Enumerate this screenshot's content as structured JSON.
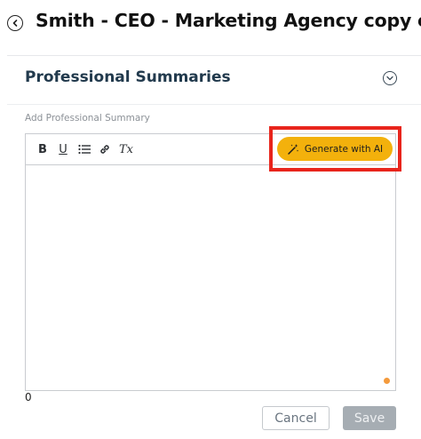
{
  "header": {
    "title": "Smith - CEO - Marketing Agency copy c"
  },
  "section": {
    "title": "Professional Summaries"
  },
  "editor": {
    "label": "Add Professional Summary",
    "toolbar": {
      "bold": "B",
      "underline": "U",
      "clear_format": "Tx"
    },
    "ai_button_label": "Generate with AI",
    "char_count": "0"
  },
  "actions": {
    "cancel": "Cancel",
    "save": "Save"
  },
  "colors": {
    "ai_button": "#f3b10c",
    "highlight": "#e8251c",
    "status_dot": "#f49a3c"
  }
}
